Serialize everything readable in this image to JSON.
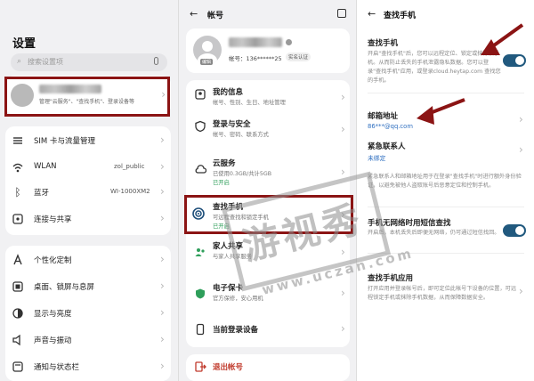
{
  "panel1": {
    "title": "设置",
    "search_placeholder": "搜索设置项",
    "account_subtitle": "管理\"云服务\"、\"查找手机\"、登录设备等",
    "items": [
      {
        "label": "SIM 卡与流量管理",
        "value": ""
      },
      {
        "label": "WLAN",
        "value": "zol_public"
      },
      {
        "label": "蓝牙",
        "value": "WI-1000XM2"
      },
      {
        "label": "连接与共享",
        "value": ""
      },
      {
        "label": "个性化定制",
        "value": ""
      },
      {
        "label": "桌面、锁屏与息屏",
        "value": ""
      },
      {
        "label": "显示与亮度",
        "value": ""
      },
      {
        "label": "声音与振动",
        "value": ""
      },
      {
        "label": "通知与状态栏",
        "value": ""
      }
    ]
  },
  "panel2": {
    "title": "帐号",
    "avatar_tag": "编辑",
    "phone": "帐号：136******25",
    "verified_badge": "实名认证",
    "items": [
      {
        "label": "我的信息",
        "sub": "帐号、性别、生日、地址管理",
        "status": ""
      },
      {
        "label": "登录与安全",
        "sub": "帐号、密码、联系方式",
        "status": ""
      },
      {
        "label": "云服务",
        "sub": "已使用0.3GB/共计5GB",
        "status": "已开启"
      },
      {
        "label": "查找手机",
        "sub": "可远程查找和锁定手机",
        "status": "已开启"
      },
      {
        "label": "家人共享",
        "sub": "与家人共享服务",
        "status": ""
      },
      {
        "label": "电子保卡",
        "sub": "官方保修，安心用机",
        "status": ""
      },
      {
        "label": "当前登录设备",
        "sub": "",
        "status": ""
      }
    ],
    "logout": "退出帐号"
  },
  "panel3": {
    "title": "查找手机",
    "find_phone": {
      "title": "查找手机",
      "desc": "开启\"查找手机\"后，您可以远程定位、锁定或抹除该手机。从而防止丢失的手机泄露隐私数据。您可以登录\"查找手机\"应用，或登录cloud.heytap.com 查找您的手机。"
    },
    "email": {
      "title": "邮箱地址",
      "value": "86***@qq.com"
    },
    "emergency": {
      "title": "紧急联系人",
      "value": "未绑定"
    },
    "emergency_desc": "紧急联系人和邮箱地址用于在登录\"查找手机\"时进行额外身份验证，以避免被他人盗取账号后恶意定位和控制手机。",
    "sms": {
      "title": "手机无网络时用短信查找",
      "desc": "开启后，本机丢失后即便无网络，仍可通过短信找回。"
    },
    "app": {
      "title": "查找手机应用",
      "desc": "打开应用并登录帐号后，即可定位此帐号下设备的位置，可远程锁定手机或抹除手机数据，从而保障数据安全。"
    }
  },
  "watermark": {
    "text": "游视秀",
    "url": "www.uczan.com"
  },
  "colors": {
    "accent_red": "#8b1414",
    "toggle_on": "#21597e",
    "link_blue": "#2f6fc0",
    "status_green": "#2e9e5a"
  }
}
